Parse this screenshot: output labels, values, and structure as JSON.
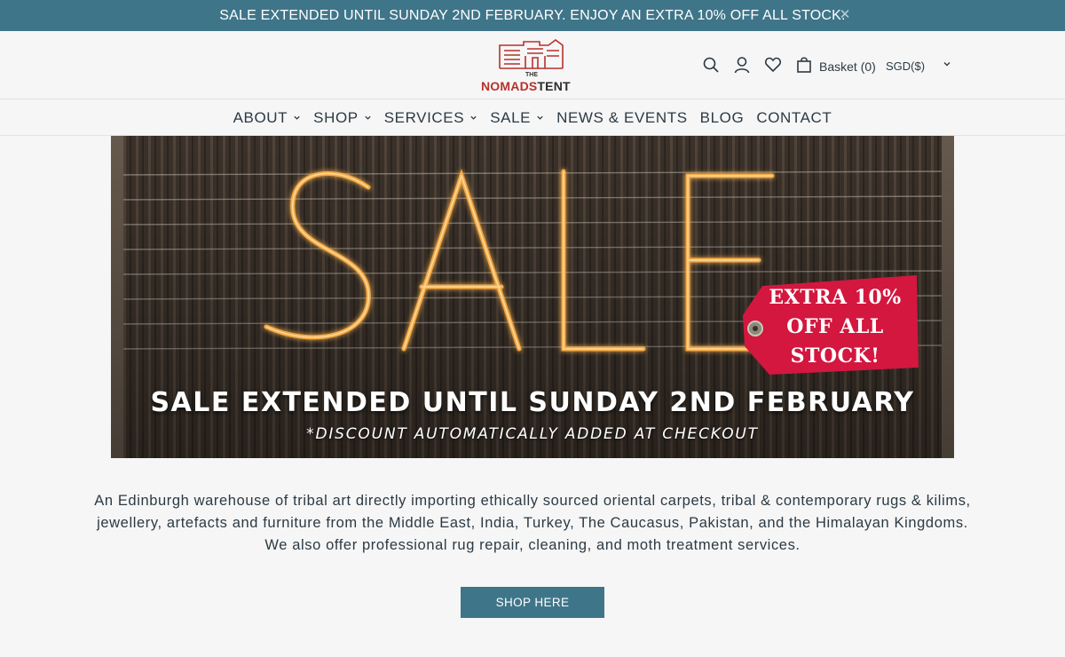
{
  "announcement": {
    "text": "SALE EXTENDED UNTIL SUNDAY 2ND FEBRUARY. ENJOY AN EXTRA 10% OFF ALL STOCK.",
    "close_icon": "close-icon"
  },
  "header": {
    "logo": {
      "the": "THE",
      "name_part1": "NOMADS",
      "name_part2": "TENT"
    },
    "icons": [
      "search-icon",
      "account-icon",
      "wishlist-heart-icon",
      "basket-bag-icon"
    ],
    "basket_label": "Basket (0)",
    "currency": "SGD($)"
  },
  "nav": {
    "items": [
      {
        "label": "ABOUT",
        "has_dropdown": true
      },
      {
        "label": "SHOP",
        "has_dropdown": true
      },
      {
        "label": "SERVICES",
        "has_dropdown": true
      },
      {
        "label": "SALE",
        "has_dropdown": true
      },
      {
        "label": "NEWS & EVENTS",
        "has_dropdown": false
      },
      {
        "label": "BLOG",
        "has_dropdown": false
      },
      {
        "label": "CONTACT",
        "has_dropdown": false
      }
    ]
  },
  "hero": {
    "sparkler_word": "SALE",
    "tag_lines": [
      "EXTRA 10%",
      "OFF ALL",
      "STOCK!"
    ],
    "headline": "SALE EXTENDED UNTIL SUNDAY 2ND FEBRUARY",
    "subline": "*DISCOUNT AUTOMATICALLY ADDED AT CHECKOUT"
  },
  "intro": {
    "lines": [
      "An Edinburgh warehouse of tribal art directly importing ethically sourced oriental carpets, tribal & contemporary rugs & kilims,",
      "jewellery, artefacts and furniture from the Middle East, India, Turkey, The Caucasus, Pakistan, and the Himalayan Kingdoms.",
      "We also offer professional rug repair, cleaning, and moth treatment services."
    ]
  },
  "cta": {
    "label": "SHOP HERE"
  },
  "colors": {
    "accent": "#3f7589",
    "logo_red": "#b7312c",
    "tag_red": "#d3173f",
    "text": "#2c3a44",
    "background": "#f6f6f6"
  }
}
